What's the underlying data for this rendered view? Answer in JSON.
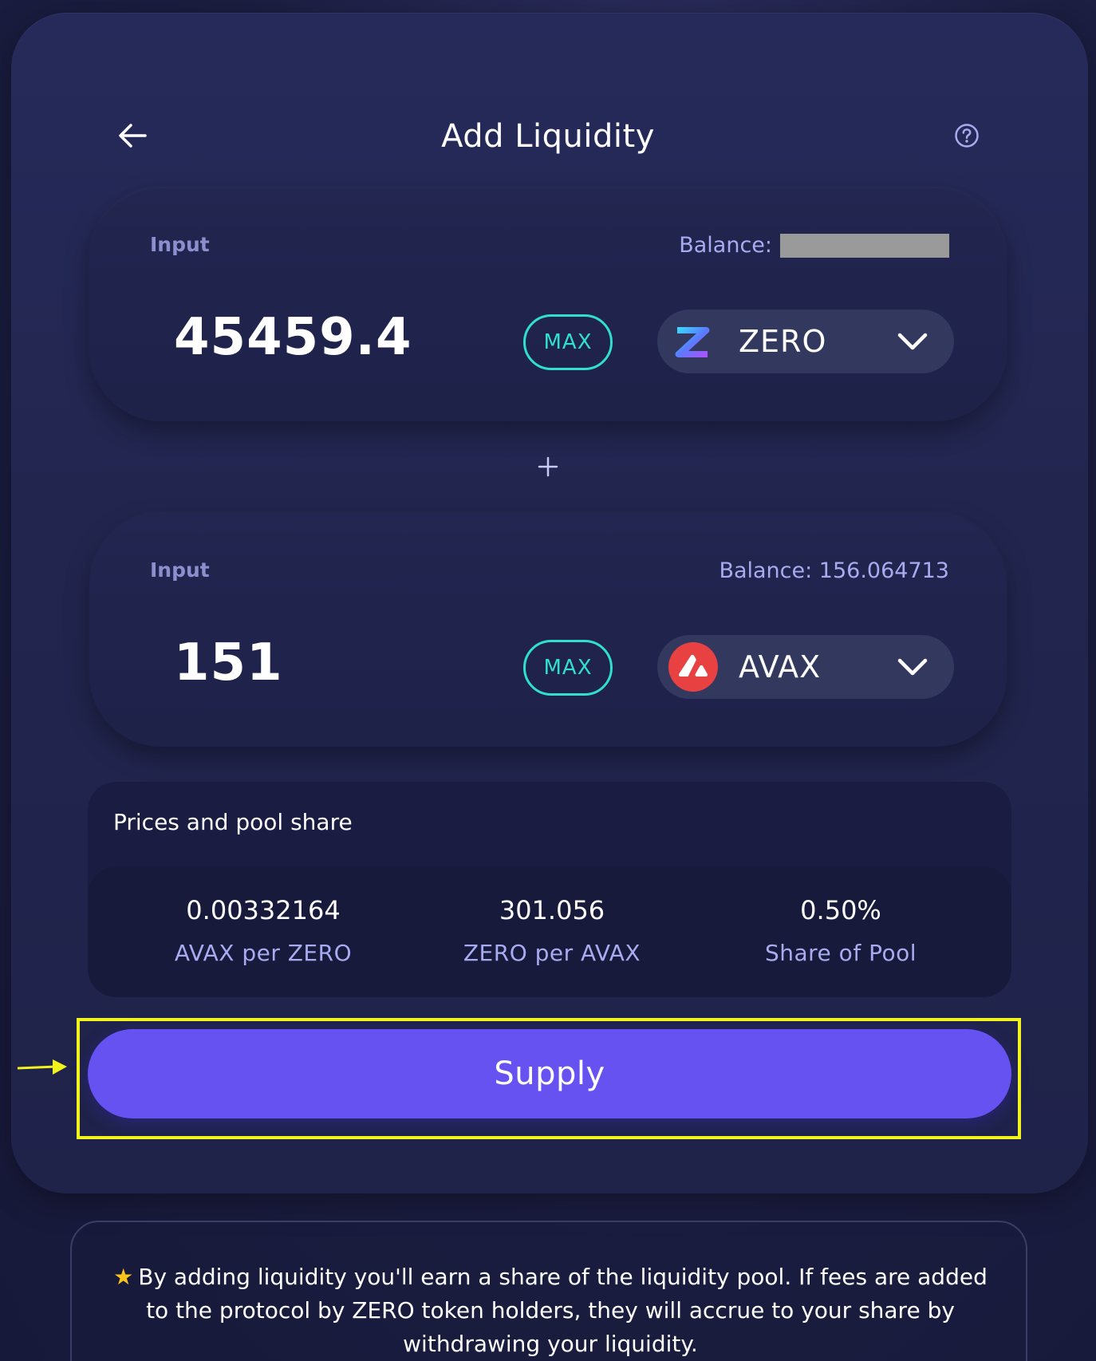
{
  "header": {
    "title": "Add Liquidity",
    "back_icon": "arrow-left-icon",
    "help_icon": "question-circle-icon"
  },
  "input_1": {
    "label": "Input",
    "balance_label": "Balance:",
    "balance_value": "",
    "balance_redacted": true,
    "amount": "45459.4",
    "max_label": "MAX",
    "token": "ZERO",
    "token_icon": "zero-token-icon"
  },
  "plus_icon": "plus-icon",
  "input_2": {
    "label": "Input",
    "balance_label": "Balance: 156.064713",
    "amount": "151",
    "max_label": "MAX",
    "token": "AVAX",
    "token_icon": "avax-token-icon"
  },
  "prices": {
    "title": "Prices and pool share",
    "stats": [
      {
        "value": "0.00332164",
        "label": "AVAX per ZERO"
      },
      {
        "value": "301.056",
        "label": "ZERO per AVAX"
      },
      {
        "value": "0.50%",
        "label": "Share of Pool"
      }
    ]
  },
  "supply_button": "Supply",
  "info": {
    "text": "By adding liquidity you'll earn a share of the liquidity pool. If fees are added to the protocol by ZERO token holders, they will accrue to your share by withdrawing your liquidity."
  },
  "colors": {
    "accent_teal": "#2fe0d0",
    "supply_purple": "#6652f0",
    "highlight_yellow": "#f2f21c",
    "avax_red": "#e84142"
  }
}
